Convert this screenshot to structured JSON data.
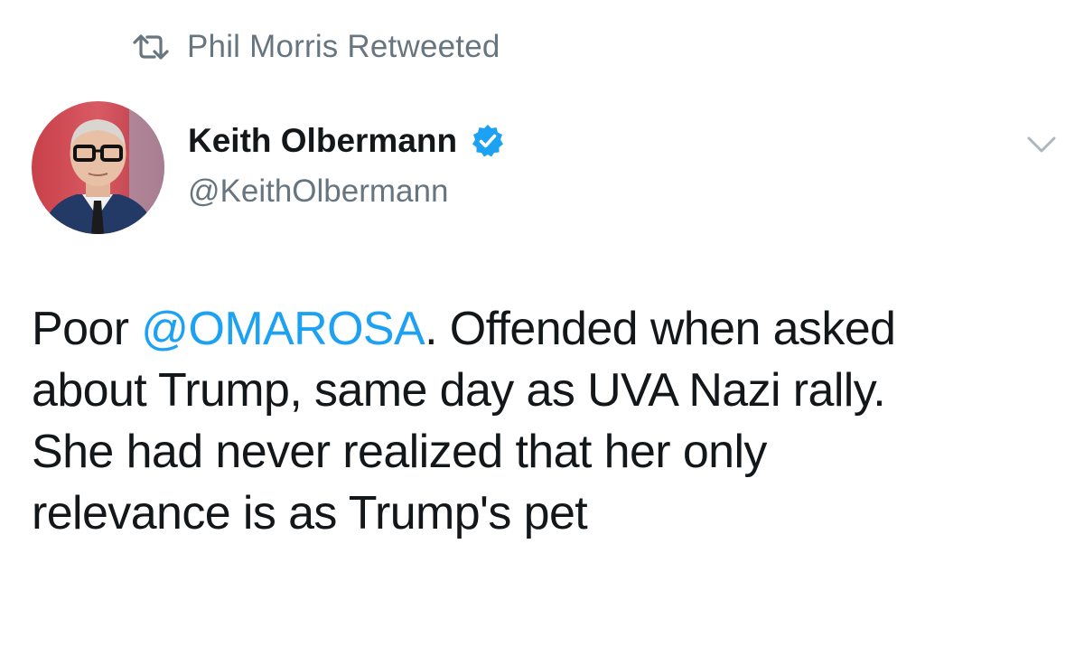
{
  "social_context": {
    "text": "Phil Morris Retweeted",
    "icon": "retweet-icon"
  },
  "author": {
    "display_name": "Keith Olbermann",
    "handle": "@KeithOlbermann",
    "verified": true,
    "verified_icon": "verified-badge-icon"
  },
  "menu": {
    "icon": "chevron-down-icon"
  },
  "tweet": {
    "lines": [
      {
        "before": "Poor ",
        "mention": "@OMAROSA",
        "after": ". Offended when asked"
      },
      {
        "text": "about Trump, same day as UVA Nazi rally."
      },
      {
        "text": "She had never realized that her only"
      },
      {
        "text": "relevance is as Trump's pet"
      }
    ]
  },
  "colors": {
    "link": "#1da1f2",
    "text": "#14171a",
    "secondary": "#66757f",
    "verified": "#1da1f2"
  }
}
